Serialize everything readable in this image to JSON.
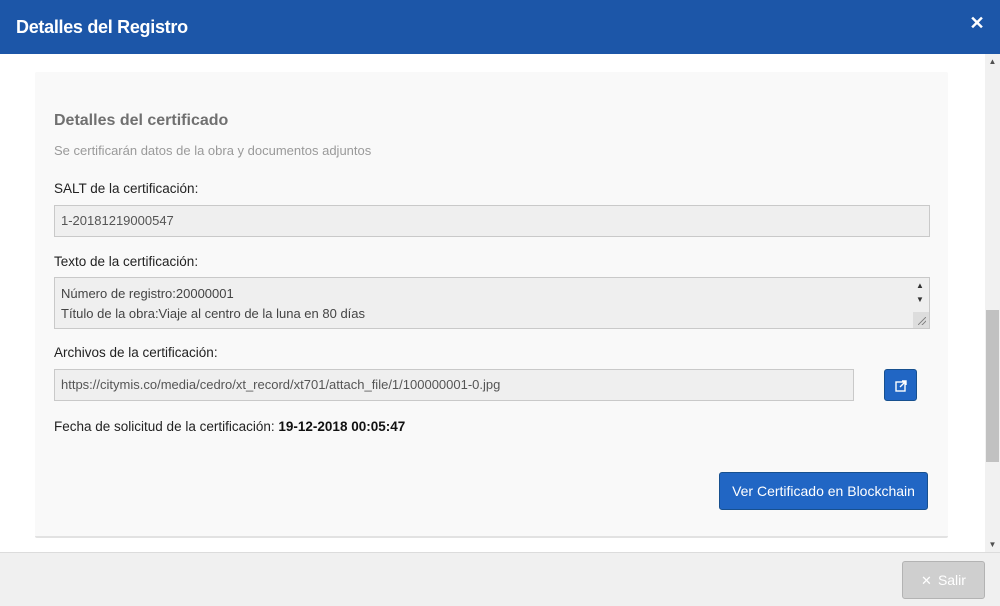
{
  "header": {
    "title": "Detalles del Registro",
    "close_glyph": "✕"
  },
  "panel": {
    "title": "Detalles del certificado",
    "subtitle": "Se certificarán datos de la obra y documentos adjuntos"
  },
  "fields": {
    "salt_label": "SALT de la certificación:",
    "salt_value": "1-20181219000547",
    "text_label": "Texto de la certificación:",
    "text_lines": [
      "Número de registro:20000001",
      "Título de la obra:Viaje al centro de la luna en 80 días"
    ],
    "files_label": "Archivos de la certificación:",
    "files_value": "https://citymis.co/media/cedro/xt_record/xt701/attach_file/1/100000001-0.jpg",
    "date_label": "Fecha de solicitud de la certificación:",
    "date_value": "19-12-2018 00:05:47"
  },
  "buttons": {
    "open_link_icon": "external-link-icon",
    "blockchain_label": "Ver Certificado en Blockchain",
    "exit_label": "Salir",
    "exit_glyph": "✕"
  },
  "colors": {
    "header_bg": "#1c56a8",
    "primary": "#2166c4"
  }
}
